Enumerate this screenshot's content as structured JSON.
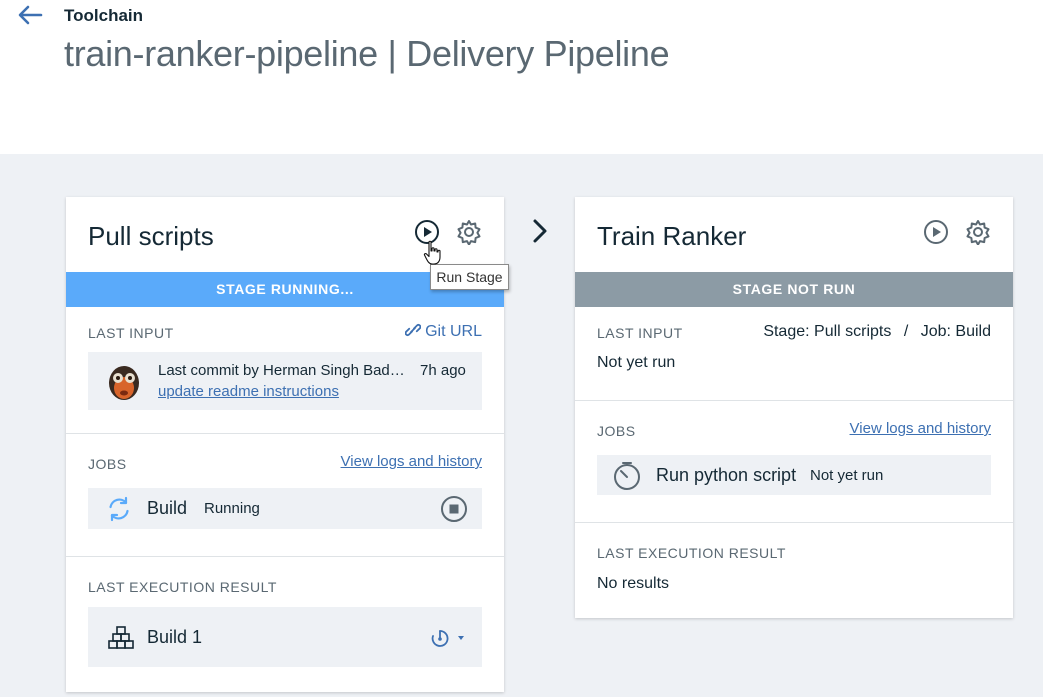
{
  "header": {
    "breadcrumb": "Toolchain",
    "title": "train-ranker-pipeline | Delivery Pipeline"
  },
  "tooltip": "Run Stage",
  "stages": [
    {
      "name": "Pull scripts",
      "status": "STAGE RUNNING...",
      "status_color": "#5aaafa",
      "last_input_label": "LAST INPUT",
      "input_link": "Git URL",
      "commit": {
        "by": "Last commit by Herman Singh Bad…",
        "age": "7h ago",
        "message": "update readme instructions"
      },
      "jobs_label": "JOBS",
      "logs_link": "View logs and history",
      "job": {
        "name": "Build",
        "status": "Running"
      },
      "result_label": "LAST EXECUTION RESULT",
      "result": "Build 1"
    },
    {
      "name": "Train Ranker",
      "status": "STAGE NOT RUN",
      "status_color": "#8c9ba5",
      "last_input_label": "LAST INPUT",
      "input_stage": "Stage: Pull scripts",
      "input_sep": "/",
      "input_job": "Job: Build",
      "input_value": "Not yet run",
      "jobs_label": "JOBS",
      "logs_link": "View logs and history",
      "job": {
        "name": "Run python script",
        "status": "Not yet run"
      },
      "result_label": "LAST EXECUTION RESULT",
      "result": "No results"
    }
  ]
}
